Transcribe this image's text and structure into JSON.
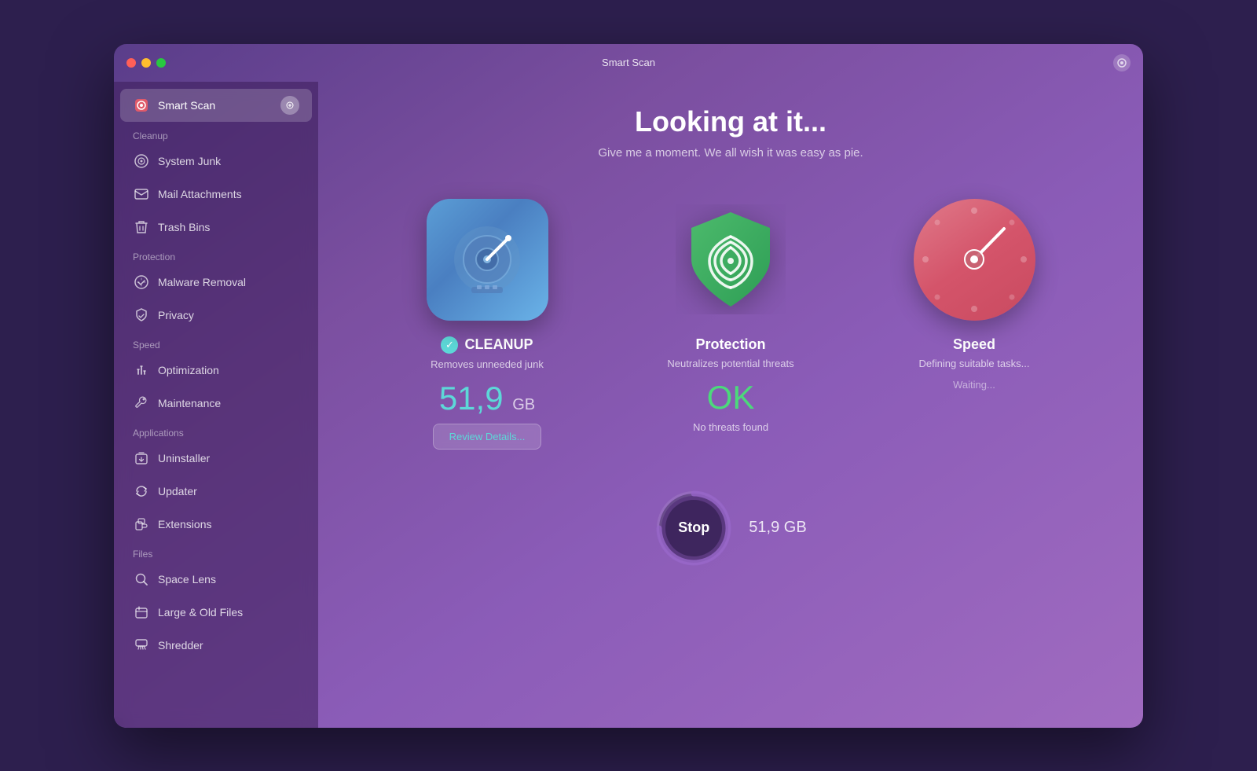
{
  "window": {
    "title": "Smart Scan"
  },
  "sidebar": {
    "smart_scan_label": "Smart Scan",
    "cleanup_section": "Cleanup",
    "cleanup_items": [
      {
        "id": "system-junk",
        "label": "System Junk",
        "icon": "⚙"
      },
      {
        "id": "mail-attachments",
        "label": "Mail Attachments",
        "icon": "✉"
      },
      {
        "id": "trash-bins",
        "label": "Trash Bins",
        "icon": "🗑"
      }
    ],
    "protection_section": "Protection",
    "protection_items": [
      {
        "id": "malware-removal",
        "label": "Malware Removal",
        "icon": "☣"
      },
      {
        "id": "privacy",
        "label": "Privacy",
        "icon": "🤚"
      }
    ],
    "speed_section": "Speed",
    "speed_items": [
      {
        "id": "optimization",
        "label": "Optimization",
        "icon": "⚡"
      },
      {
        "id": "maintenance",
        "label": "Maintenance",
        "icon": "🔧"
      }
    ],
    "applications_section": "Applications",
    "applications_items": [
      {
        "id": "uninstaller",
        "label": "Uninstaller",
        "icon": "🗑"
      },
      {
        "id": "updater",
        "label": "Updater",
        "icon": "🔄"
      },
      {
        "id": "extensions",
        "label": "Extensions",
        "icon": "🧩"
      }
    ],
    "files_section": "Files",
    "files_items": [
      {
        "id": "space-lens",
        "label": "Space Lens",
        "icon": "🔍"
      },
      {
        "id": "large-old-files",
        "label": "Large & Old Files",
        "icon": "📁"
      },
      {
        "id": "shredder",
        "label": "Shredder",
        "icon": "🖨"
      }
    ]
  },
  "main": {
    "title": "Looking at it...",
    "subtitle": "Give me a moment. We all wish it was easy as pie.",
    "cleanup_card": {
      "title": "CLEANUP",
      "subtitle": "Removes unneeded junk",
      "value": "51,9",
      "unit": "GB",
      "review_btn": "Review Details..."
    },
    "protection_card": {
      "title": "Protection",
      "subtitle": "Neutralizes potential threats",
      "status_ok": "OK",
      "status_label": "No threats found"
    },
    "speed_card": {
      "title": "Speed",
      "subtitle": "Defining suitable tasks...",
      "waiting": "Waiting..."
    },
    "stop_btn": "Stop",
    "stop_size": "51,9 GB"
  }
}
